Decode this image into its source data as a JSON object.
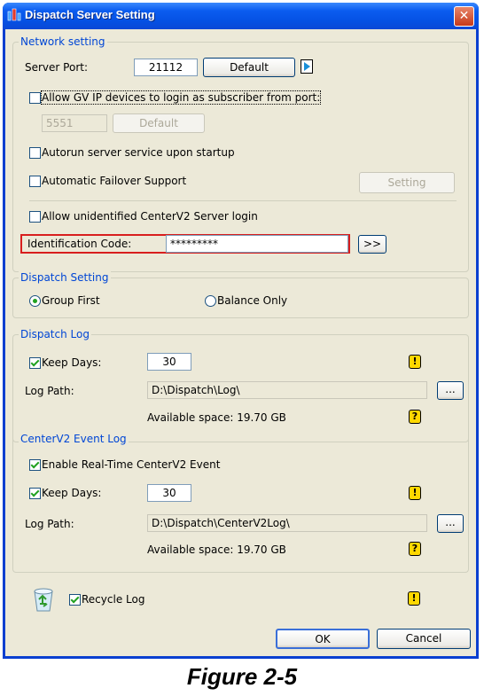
{
  "window": {
    "title": "Dispatch Server Setting",
    "close_glyph": "✕"
  },
  "network": {
    "legend": "Network setting",
    "server_port_label": "Server Port:",
    "server_port_value": "21112",
    "default_label": "Default",
    "arrow_glyph": "▶",
    "allow_gv_label": "Allow GV IP devices to login as subscriber from port:",
    "gv_port_value": "5551",
    "gv_default_label": "Default",
    "autorun_label": "Autorun server service upon startup",
    "failover_label": "Automatic Failover Support",
    "setting_label": "Setting",
    "allow_unidentified_label": "Allow unidentified CenterV2 Server login",
    "ident_label": "Identification Code:",
    "ident_value": "*********",
    "ident_btn": ">>"
  },
  "dispatch_setting": {
    "legend": "Dispatch Setting",
    "group_first": "Group First",
    "balance_only": "Balance Only"
  },
  "dispatch_log": {
    "legend": "Dispatch Log",
    "keep_days_label": "Keep Days:",
    "keep_days_value": "30",
    "log_path_label": "Log Path:",
    "log_path_value": "D:\\Dispatch\\Log\\",
    "browse_label": "...",
    "available_space": "Available space: 19.70 GB",
    "warn_glyph": "!",
    "help_glyph": "?"
  },
  "event_log": {
    "legend": "CenterV2 Event Log",
    "enable_label": "Enable Real-Time CenterV2 Event",
    "keep_days_label": "Keep Days:",
    "keep_days_value": "30",
    "log_path_label": "Log Path:",
    "log_path_value": "D:\\Dispatch\\CenterV2Log\\",
    "browse_label": "...",
    "available_space": "Available space: 19.70 GB",
    "warn_glyph": "!",
    "help_glyph": "?"
  },
  "recycle": {
    "label": "Recycle Log",
    "warn_glyph": "!"
  },
  "buttons": {
    "ok": "OK",
    "cancel": "Cancel"
  },
  "caption": "Figure 2-5",
  "colors": {
    "titlebar": "#0551e3",
    "legend": "#0046d5",
    "highlight_border": "#d81e1e",
    "warn_bg": "#ffd800"
  }
}
